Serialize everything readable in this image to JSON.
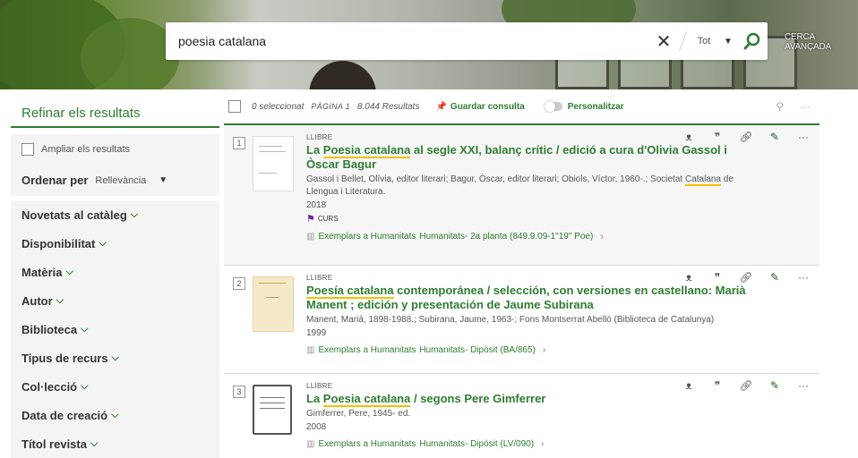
{
  "search": {
    "query": "poesia catalana",
    "scope": "Tot",
    "advanced": "CERCA AVANÇADA"
  },
  "left": {
    "title": "Refinar els resultats",
    "expand": "Ampliar els resultats",
    "sort_label": "Ordenar per",
    "sort_value": "Rellevància",
    "facets": [
      "Novetats al catàleg",
      "Disponibilitat",
      "Matèria",
      "Autor",
      "Biblioteca",
      "Tipus de recurs",
      "Col·lecció",
      "Data de creació",
      "Títol revista"
    ]
  },
  "toolbar": {
    "selected": "0 seleccionat",
    "page": "PÀGINA 1",
    "results": "8.044 Resultats",
    "save": "Guardar consulta",
    "personalize": "Personalitzar"
  },
  "results": [
    {
      "num": "1",
      "type": "LLIBRE",
      "title_pre": "La ",
      "title_hl": "Poesia catalana",
      "title_post": " al segle XXI, balanç crític / edició a cura d'Olivia Gassol i Òscar Bagur",
      "authors_pre": "Gassol i Bellet, Olívia, editor literari; Bagur, Òscar, editor literari; Obiols, Víctor, 1960-.; Societat ",
      "authors_hl": "Catalana",
      "authors_post": " de Llengua i Literatura.",
      "year": "2018",
      "course": "CURS",
      "avail_label": "Exemplars a Humanitats",
      "avail_loc": "Humanitats- 2a planta (849.9.09-1\"19\" Poe)"
    },
    {
      "num": "2",
      "type": "LLIBRE",
      "title_pre": "",
      "title_hl": "Poesía catalana",
      "title_post": " contemporánea / selección, con versiones en castellano: Marià Manent ; edición y presentación de Jaume Subirana",
      "authors": "Manent, Marià, 1898-1988.; Subirana, Jaume, 1963-; Fons Montserrat Abelló (Biblioteca de Catalunya)",
      "year": "1999",
      "avail_label": "Exemplars a Humanitats",
      "avail_loc": "Humanitats- Dipòsit (BA/865)"
    },
    {
      "num": "3",
      "type": "LLIBRE",
      "title_pre": "La ",
      "title_hl": "Poesia catalana",
      "title_post": " / segons Pere Gimferrer",
      "authors": "Gimferrer, Pere, 1945- ed.",
      "year": "2008",
      "avail_label": "Exemplars a Humanitats",
      "avail_loc": "Humanitats- Dipòsit (LV/090)"
    }
  ],
  "colors": {
    "accent": "#2e7d32",
    "highlight": "#f2c100"
  }
}
